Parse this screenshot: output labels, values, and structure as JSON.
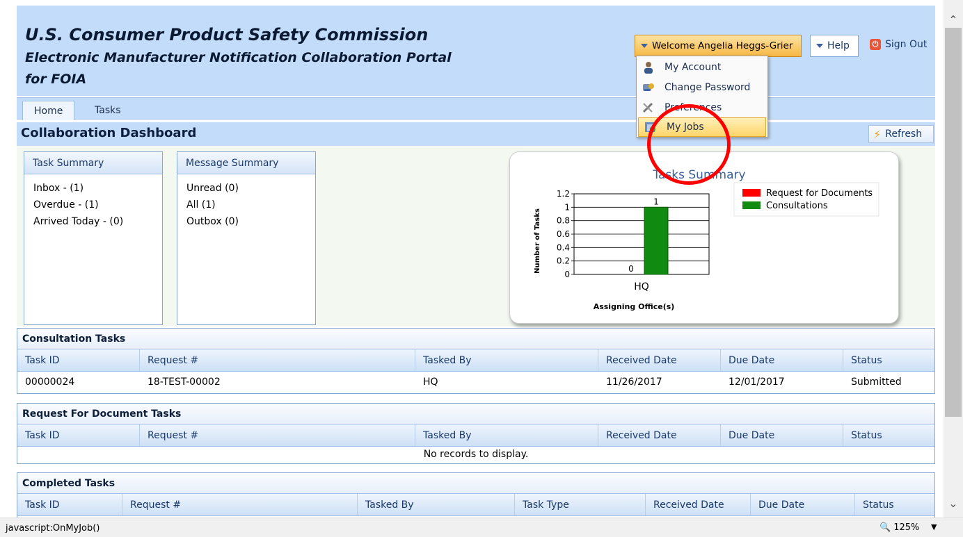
{
  "header": {
    "title1": "U.S. Consumer Product Safety Commission",
    "title2": "Electronic Manufacturer Notification Collaboration Portal",
    "title3": "for FOIA",
    "welcome": "Welcome Angelia Heggs-Grier",
    "help": "Help",
    "sign_out": "Sign Out"
  },
  "user_menu": {
    "items": [
      {
        "label": "My Account",
        "icon": "user-icon"
      },
      {
        "label": "Change Password",
        "icon": "key-icon"
      },
      {
        "label": "Preferences",
        "icon": "tools-icon"
      },
      {
        "label": "My Jobs",
        "icon": "jobs-icon",
        "highlighted": true
      }
    ]
  },
  "tabs": [
    {
      "label": "Home",
      "active": true
    },
    {
      "label": "Tasks",
      "active": false
    }
  ],
  "dashboard": {
    "title": "Collaboration Dashboard",
    "refresh": "Refresh"
  },
  "task_summary": {
    "header": "Task Summary",
    "items": [
      "Inbox - (1)",
      "Overdue - (1)",
      "Arrived Today - (0)"
    ]
  },
  "message_summary": {
    "header": "Message Summary",
    "items": [
      "Unread (0)",
      "All (1)",
      "Outbox (0)"
    ]
  },
  "chart_data": {
    "type": "bar",
    "title": "Tasks Summary",
    "xlabel": "Assigning Office(s)",
    "ylabel": "Number of Tasks",
    "categories": [
      "HQ"
    ],
    "series": [
      {
        "name": "Request for Documents",
        "values": [
          0
        ],
        "color": "#ff0000"
      },
      {
        "name": "Consultations",
        "values": [
          1
        ],
        "color": "#108a10"
      }
    ],
    "ylim": [
      0,
      1.2
    ],
    "yticks": [
      "0",
      "0.2",
      "0.4",
      "0.6",
      "0.8",
      "1",
      "1.2"
    ],
    "legend": "top-right",
    "grid": true
  },
  "consultation_tasks": {
    "title": "Consultation Tasks",
    "columns": [
      "Task ID",
      "Request #",
      "Tasked By",
      "Received Date",
      "Due Date",
      "Status"
    ],
    "rows": [
      [
        "00000024",
        "18-TEST-00002",
        "HQ",
        "11/26/2017",
        "12/01/2017",
        "Submitted"
      ]
    ]
  },
  "rfd_tasks": {
    "title": "Request For Document Tasks",
    "columns": [
      "Task ID",
      "Request #",
      "Tasked By",
      "Received Date",
      "Due Date",
      "Status"
    ],
    "empty": "No records to display."
  },
  "completed_tasks": {
    "title": "Completed Tasks",
    "columns": [
      "Task ID",
      "Request #",
      "Tasked By",
      "Task Type",
      "Received Date",
      "Due Date",
      "Status"
    ]
  },
  "status_bar": {
    "text": "javascript:OnMyJob()",
    "zoom": "125%"
  }
}
